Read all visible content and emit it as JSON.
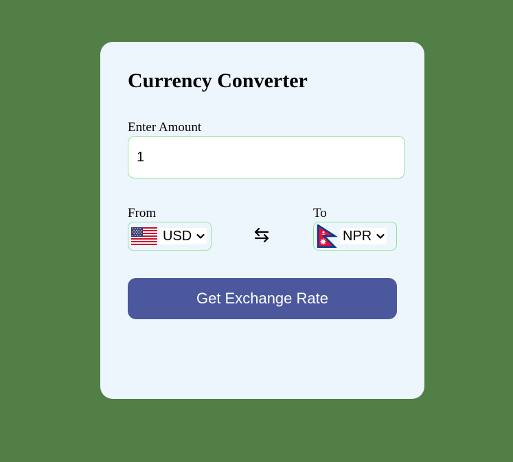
{
  "converter": {
    "title": "Currency Converter",
    "amount_label": "Enter Amount",
    "amount_value": "1",
    "from_label": "From",
    "from_currency": "USD",
    "from_flag_icon": "us-flag-icon",
    "to_label": "To",
    "to_currency": "NPR",
    "to_flag_icon": "nepal-flag-icon",
    "swap_icon": "swap-arrows-icon",
    "button_label": "Get Exchange Rate"
  },
  "colors": {
    "page_background": "#517f45",
    "card_background": "#eef6fd",
    "field_border": "#8fe39a",
    "button_background": "#4b589e",
    "button_text": "#ffffff"
  }
}
